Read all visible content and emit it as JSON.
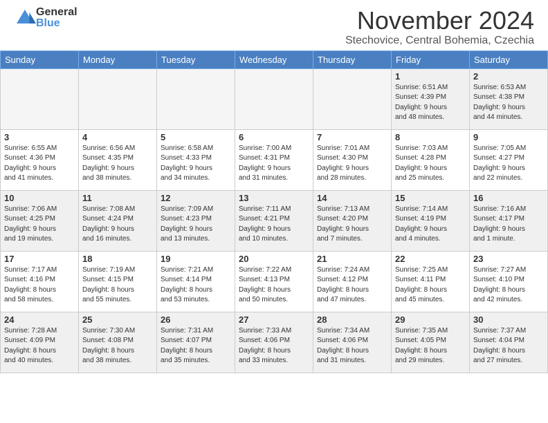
{
  "header": {
    "logo_general": "General",
    "logo_blue": "Blue",
    "month_title": "November 2024",
    "location": "Stechovice, Central Bohemia, Czechia"
  },
  "weekdays": [
    "Sunday",
    "Monday",
    "Tuesday",
    "Wednesday",
    "Thursday",
    "Friday",
    "Saturday"
  ],
  "weeks": [
    [
      {
        "day": "",
        "info": "",
        "empty": true
      },
      {
        "day": "",
        "info": "",
        "empty": true
      },
      {
        "day": "",
        "info": "",
        "empty": true
      },
      {
        "day": "",
        "info": "",
        "empty": true
      },
      {
        "day": "",
        "info": "",
        "empty": true
      },
      {
        "day": "1",
        "info": "Sunrise: 6:51 AM\nSunset: 4:39 PM\nDaylight: 9 hours\nand 48 minutes.",
        "empty": false
      },
      {
        "day": "2",
        "info": "Sunrise: 6:53 AM\nSunset: 4:38 PM\nDaylight: 9 hours\nand 44 minutes.",
        "empty": false
      }
    ],
    [
      {
        "day": "3",
        "info": "Sunrise: 6:55 AM\nSunset: 4:36 PM\nDaylight: 9 hours\nand 41 minutes.",
        "empty": false
      },
      {
        "day": "4",
        "info": "Sunrise: 6:56 AM\nSunset: 4:35 PM\nDaylight: 9 hours\nand 38 minutes.",
        "empty": false
      },
      {
        "day": "5",
        "info": "Sunrise: 6:58 AM\nSunset: 4:33 PM\nDaylight: 9 hours\nand 34 minutes.",
        "empty": false
      },
      {
        "day": "6",
        "info": "Sunrise: 7:00 AM\nSunset: 4:31 PM\nDaylight: 9 hours\nand 31 minutes.",
        "empty": false
      },
      {
        "day": "7",
        "info": "Sunrise: 7:01 AM\nSunset: 4:30 PM\nDaylight: 9 hours\nand 28 minutes.",
        "empty": false
      },
      {
        "day": "8",
        "info": "Sunrise: 7:03 AM\nSunset: 4:28 PM\nDaylight: 9 hours\nand 25 minutes.",
        "empty": false
      },
      {
        "day": "9",
        "info": "Sunrise: 7:05 AM\nSunset: 4:27 PM\nDaylight: 9 hours\nand 22 minutes.",
        "empty": false
      }
    ],
    [
      {
        "day": "10",
        "info": "Sunrise: 7:06 AM\nSunset: 4:25 PM\nDaylight: 9 hours\nand 19 minutes.",
        "empty": false
      },
      {
        "day": "11",
        "info": "Sunrise: 7:08 AM\nSunset: 4:24 PM\nDaylight: 9 hours\nand 16 minutes.",
        "empty": false
      },
      {
        "day": "12",
        "info": "Sunrise: 7:09 AM\nSunset: 4:23 PM\nDaylight: 9 hours\nand 13 minutes.",
        "empty": false
      },
      {
        "day": "13",
        "info": "Sunrise: 7:11 AM\nSunset: 4:21 PM\nDaylight: 9 hours\nand 10 minutes.",
        "empty": false
      },
      {
        "day": "14",
        "info": "Sunrise: 7:13 AM\nSunset: 4:20 PM\nDaylight: 9 hours\nand 7 minutes.",
        "empty": false
      },
      {
        "day": "15",
        "info": "Sunrise: 7:14 AM\nSunset: 4:19 PM\nDaylight: 9 hours\nand 4 minutes.",
        "empty": false
      },
      {
        "day": "16",
        "info": "Sunrise: 7:16 AM\nSunset: 4:17 PM\nDaylight: 9 hours\nand 1 minute.",
        "empty": false
      }
    ],
    [
      {
        "day": "17",
        "info": "Sunrise: 7:17 AM\nSunset: 4:16 PM\nDaylight: 8 hours\nand 58 minutes.",
        "empty": false
      },
      {
        "day": "18",
        "info": "Sunrise: 7:19 AM\nSunset: 4:15 PM\nDaylight: 8 hours\nand 55 minutes.",
        "empty": false
      },
      {
        "day": "19",
        "info": "Sunrise: 7:21 AM\nSunset: 4:14 PM\nDaylight: 8 hours\nand 53 minutes.",
        "empty": false
      },
      {
        "day": "20",
        "info": "Sunrise: 7:22 AM\nSunset: 4:13 PM\nDaylight: 8 hours\nand 50 minutes.",
        "empty": false
      },
      {
        "day": "21",
        "info": "Sunrise: 7:24 AM\nSunset: 4:12 PM\nDaylight: 8 hours\nand 47 minutes.",
        "empty": false
      },
      {
        "day": "22",
        "info": "Sunrise: 7:25 AM\nSunset: 4:11 PM\nDaylight: 8 hours\nand 45 minutes.",
        "empty": false
      },
      {
        "day": "23",
        "info": "Sunrise: 7:27 AM\nSunset: 4:10 PM\nDaylight: 8 hours\nand 42 minutes.",
        "empty": false
      }
    ],
    [
      {
        "day": "24",
        "info": "Sunrise: 7:28 AM\nSunset: 4:09 PM\nDaylight: 8 hours\nand 40 minutes.",
        "empty": false
      },
      {
        "day": "25",
        "info": "Sunrise: 7:30 AM\nSunset: 4:08 PM\nDaylight: 8 hours\nand 38 minutes.",
        "empty": false
      },
      {
        "day": "26",
        "info": "Sunrise: 7:31 AM\nSunset: 4:07 PM\nDaylight: 8 hours\nand 35 minutes.",
        "empty": false
      },
      {
        "day": "27",
        "info": "Sunrise: 7:33 AM\nSunset: 4:06 PM\nDaylight: 8 hours\nand 33 minutes.",
        "empty": false
      },
      {
        "day": "28",
        "info": "Sunrise: 7:34 AM\nSunset: 4:06 PM\nDaylight: 8 hours\nand 31 minutes.",
        "empty": false
      },
      {
        "day": "29",
        "info": "Sunrise: 7:35 AM\nSunset: 4:05 PM\nDaylight: 8 hours\nand 29 minutes.",
        "empty": false
      },
      {
        "day": "30",
        "info": "Sunrise: 7:37 AM\nSunset: 4:04 PM\nDaylight: 8 hours\nand 27 minutes.",
        "empty": false
      }
    ]
  ]
}
